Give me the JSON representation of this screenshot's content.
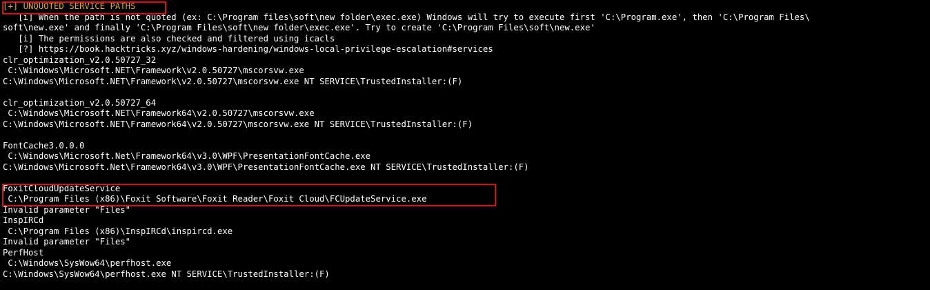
{
  "terminal": {
    "colors": {
      "background": "#000000",
      "text": "#ffffff",
      "header": "#e8a33c",
      "highlight_box": "#d0141a"
    },
    "lines": [
      {
        "text": "[+] UNQUOTED SERVICE PATHS",
        "style": "orange"
      },
      {
        "text": "   [i] When the path is not quoted (ex: C:\\Program files\\soft\\new folder\\exec.exe) Windows will try to execute first 'C:\\Program.exe', then 'C:\\Program Files\\",
        "style": "normal"
      },
      {
        "text": "soft\\new.exe' and finally 'C:\\Program Files\\soft\\new folder\\exec.exe'. Try to create 'C:\\Program Files\\soft\\new.exe'",
        "style": "normal"
      },
      {
        "text": "   [i] The permissions are also checked and filtered using icacls",
        "style": "normal"
      },
      {
        "text": "   [?] https://book.hacktricks.xyz/windows-hardening/windows-local-privilege-escalation#services",
        "style": "normal"
      },
      {
        "text": "clr_optimization_v2.0.50727_32",
        "style": "normal"
      },
      {
        "text": " C:\\Windows\\Microsoft.NET\\Framework\\v2.0.50727\\mscorsvw.exe",
        "style": "normal"
      },
      {
        "text": "C:\\Windows\\Microsoft.NET\\Framework\\v2.0.50727\\mscorsvw.exe NT SERVICE\\TrustedInstaller:(F)",
        "style": "normal"
      },
      {
        "text": "",
        "style": "blank"
      },
      {
        "text": "clr_optimization_v2.0.50727_64",
        "style": "normal"
      },
      {
        "text": " C:\\Windows\\Microsoft.NET\\Framework64\\v2.0.50727\\mscorsvw.exe",
        "style": "normal"
      },
      {
        "text": "C:\\Windows\\Microsoft.NET\\Framework64\\v2.0.50727\\mscorsvw.exe NT SERVICE\\TrustedInstaller:(F)",
        "style": "normal"
      },
      {
        "text": "",
        "style": "blank"
      },
      {
        "text": "FontCache3.0.0.0",
        "style": "normal"
      },
      {
        "text": " C:\\Windows\\Microsoft.Net\\Framework64\\v3.0\\WPF\\PresentationFontCache.exe",
        "style": "normal"
      },
      {
        "text": "C:\\Windows\\Microsoft.Net\\Framework64\\v3.0\\WPF\\PresentationFontCache.exe NT SERVICE\\TrustedInstaller:(F)",
        "style": "normal"
      },
      {
        "text": "",
        "style": "blank"
      },
      {
        "text": "FoxitCloudUpdateService",
        "style": "normal"
      },
      {
        "text": " C:\\Program Files (x86)\\Foxit Software\\Foxit Reader\\Foxit Cloud\\FCUpdateService.exe",
        "style": "normal"
      },
      {
        "text": "Invalid parameter \"Files\"",
        "style": "normal"
      },
      {
        "text": "InspIRCd",
        "style": "normal"
      },
      {
        "text": " C:\\Program Files (x86)\\InspIRCd\\inspircd.exe",
        "style": "normal"
      },
      {
        "text": "Invalid parameter \"Files\"",
        "style": "normal"
      },
      {
        "text": "PerfHost",
        "style": "normal"
      },
      {
        "text": " C:\\Windows\\SysWow64\\perfhost.exe",
        "style": "normal"
      },
      {
        "text": "C:\\Windows\\SysWow64\\perfhost.exe NT SERVICE\\TrustedInstaller:(F)",
        "style": "normal"
      }
    ]
  }
}
